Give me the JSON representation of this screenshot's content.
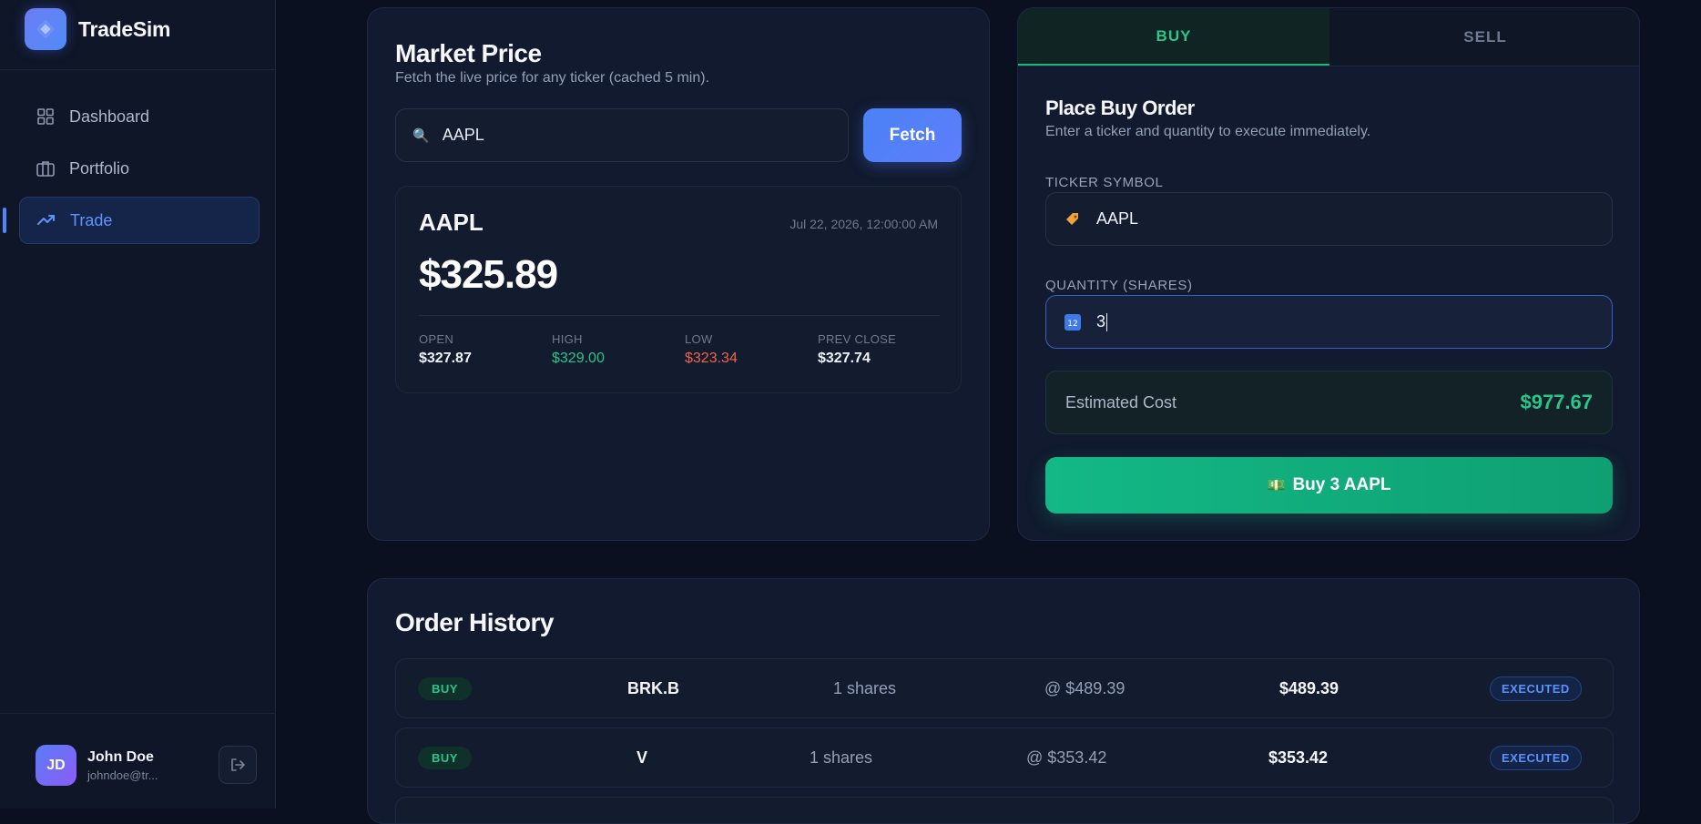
{
  "app": {
    "name": "TradeSim"
  },
  "sidebar": {
    "items": [
      {
        "label": "Dashboard",
        "icon": "grid-icon"
      },
      {
        "label": "Portfolio",
        "icon": "briefcase-icon"
      },
      {
        "label": "Trade",
        "icon": "trending-up-icon",
        "active": true
      }
    ],
    "user": {
      "initials": "JD",
      "name": "John Doe",
      "email": "johndoe@tr..."
    }
  },
  "market": {
    "title": "Market Price",
    "subtitle": "Fetch the live price for any ticker (cached 5 min).",
    "search_value": "AAPL",
    "fetch_label": "Fetch",
    "quote": {
      "symbol": "AAPL",
      "timestamp": "Jul 22, 2026, 12:00:00 AM",
      "price": "$325.89",
      "stats": [
        {
          "label": "OPEN",
          "value": "$327.87",
          "tone": "neutral"
        },
        {
          "label": "HIGH",
          "value": "$329.00",
          "tone": "green"
        },
        {
          "label": "LOW",
          "value": "$323.34",
          "tone": "red"
        },
        {
          "label": "PREV CLOSE",
          "value": "$327.74",
          "tone": "neutral"
        }
      ]
    }
  },
  "order": {
    "tabs": [
      "BUY",
      "SELL"
    ],
    "active_tab": "BUY",
    "title": "Place Buy Order",
    "subtitle": "Enter a ticker and quantity to execute immediately.",
    "ticker_label": "TICKER SYMBOL",
    "ticker_value": "AAPL",
    "quantity_label": "QUANTITY (SHARES)",
    "quantity_value": "3",
    "estimate_label": "Estimated Cost",
    "estimate_value": "$977.67",
    "buy_label": "Buy 3 AAPL"
  },
  "history": {
    "title": "Order History",
    "rows": [
      {
        "side": "BUY",
        "symbol": "BRK.B",
        "shares": "1 shares",
        "price": "@ $489.39",
        "total": "$489.39",
        "status": "EXECUTED"
      },
      {
        "side": "BUY",
        "symbol": "V",
        "shares": "1 shares",
        "price": "@ $353.42",
        "total": "$353.42",
        "status": "EXECUTED"
      }
    ]
  },
  "colors": {
    "background": "#0b1020",
    "accent_blue": "#4f86ff",
    "accent_green": "#2bc48a",
    "negative_red": "#f06548"
  }
}
